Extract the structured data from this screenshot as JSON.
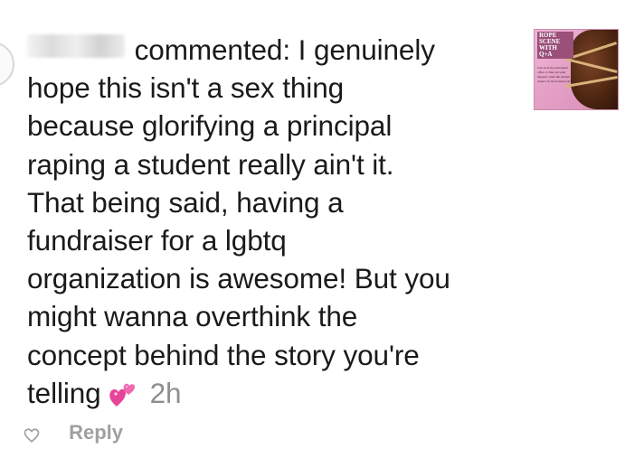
{
  "comment": {
    "username": "user",
    "action": "commented:",
    "text": "I genuinely hope this isn't a sex thing because glorifying a principal raping a student really ain't it. That being said, having a fundraiser for a lgbtq organization is awesome! But you might wanna overthink the concept behind the story you're telling",
    "lines": [
      "hope this isn't a sex thing",
      "because glorifying a principal",
      "raping a student really ain't it.",
      "That being said, having a",
      "fundraiser for a lgbtq",
      "organization is awesome! But you",
      "might wanna overthink the",
      "concept behind the story you're"
    ],
    "first_line_rest": "I genuinely",
    "last_line_text": "telling",
    "emoji": "two-hearts-emoji",
    "timestamp": "2h"
  },
  "thumbnail": {
    "title": "ROPE SCENE WITH Q+A",
    "small_text": "Join us in the principal's office to find out what happens when the student doesn't do her homework!"
  },
  "footer": {
    "reply_label": "Reply"
  },
  "colors": {
    "text": "#1a1a1a",
    "timestamp": "#8e8e8e",
    "emoji_pink": "#e8439a",
    "thumbnail_bg": "#e5a2c7"
  }
}
